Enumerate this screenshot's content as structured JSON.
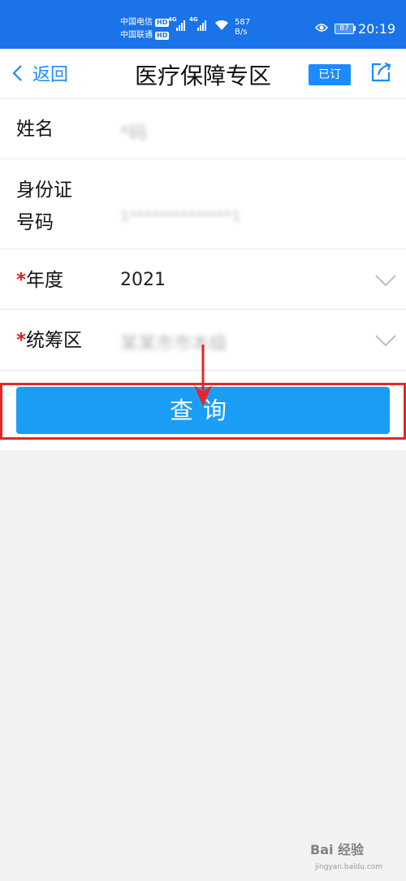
{
  "status_bar": {
    "carrier_1": "中国电信",
    "carrier_2": "中国联通",
    "hd_label": "HD",
    "signal_tag": "4G",
    "net_speed_value": "587",
    "net_speed_unit": "B/s",
    "battery": "87",
    "time": "20:19"
  },
  "nav": {
    "back_label": "返回",
    "title": "医疗保障专区",
    "subscribed_label": "已订"
  },
  "form": {
    "name_label": "姓名",
    "name_value": "*码",
    "id_label_line1": "身份证",
    "id_label_line2": "号码",
    "id_value": "1**************1",
    "year_label": "年度",
    "year_value": "2021",
    "region_label": "统筹区",
    "region_value": "某某市市本级",
    "required_mark": "*"
  },
  "query_button": {
    "label": "查询"
  },
  "watermark": {
    "text": "Bai 经验",
    "sub": "jingyan.baidu.com"
  },
  "colors": {
    "status_bar": "#1a73e8",
    "accent": "#1a8cff",
    "button": "#1a9ef5",
    "highlight": "#e32626"
  }
}
